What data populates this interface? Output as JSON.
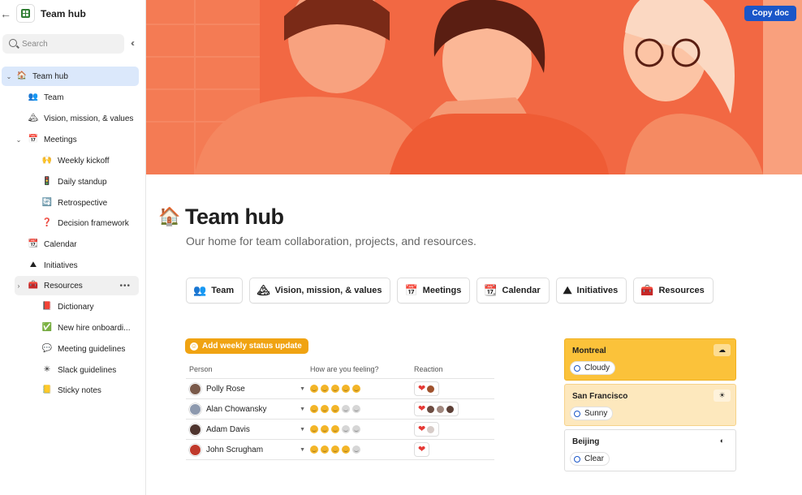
{
  "sidebar": {
    "doc_title": "Team hub",
    "search_placeholder": "Search",
    "items": [
      {
        "label": "Team hub",
        "icon": "🏠"
      },
      {
        "label": "Team",
        "icon": "👥"
      },
      {
        "label": "Vision, mission, & values",
        "icon": "🏔"
      },
      {
        "label": "Meetings",
        "icon": "📅"
      },
      {
        "label": "Weekly kickoff",
        "icon": "🙌"
      },
      {
        "label": "Daily standup",
        "icon": "🚦"
      },
      {
        "label": "Retrospective",
        "icon": "🔄"
      },
      {
        "label": "Decision framework",
        "icon": "❓"
      },
      {
        "label": "Calendar",
        "icon": "📆"
      },
      {
        "label": "Initiatives",
        "icon": "⛰"
      },
      {
        "label": "Resources",
        "icon": "🧰"
      },
      {
        "label": "Dictionary",
        "icon": "📕"
      },
      {
        "label": "New hire onboardi...",
        "icon": "✅"
      },
      {
        "label": "Meeting guidelines",
        "icon": "💬"
      },
      {
        "label": "Slack guidelines",
        "icon": "✳"
      },
      {
        "label": "Sticky notes",
        "icon": "📒"
      }
    ]
  },
  "header": {
    "copy_label": "Copy doc"
  },
  "page": {
    "icon": "🏠",
    "title": "Team hub",
    "subtitle": "Our home for team collaboration, projects, and resources."
  },
  "pills": [
    {
      "label": "Team",
      "icon": "👥"
    },
    {
      "label": "Vision, mission, & values",
      "icon": "🏔"
    },
    {
      "label": "Meetings",
      "icon": "📅"
    },
    {
      "label": "Calendar",
      "icon": "📆"
    },
    {
      "label": "Initiatives",
      "icon": "⛰"
    },
    {
      "label": "Resources",
      "icon": "🧰"
    }
  ],
  "status": {
    "button_label": "Add weekly status update",
    "columns": [
      "Person",
      "How are you feeling?",
      "Reaction"
    ],
    "rows": [
      {
        "name": "Polly Rose",
        "feeling": 5,
        "avatar_color": "#7a5a4a",
        "reactors": [
          "#a0522d"
        ]
      },
      {
        "name": "Alan Chowansky",
        "feeling": 3,
        "avatar_color": "#8d99ae",
        "reactors": [
          "#6d4c41",
          "#a1887f",
          "#5d4037"
        ]
      },
      {
        "name": "Adam Davis",
        "feeling": 3,
        "avatar_color": "#4e342e",
        "reactors": [
          "#d7ccc8"
        ]
      },
      {
        "name": "John Scrugham",
        "feeling": 4,
        "avatar_color": "#c0392b",
        "reactors": []
      }
    ]
  },
  "weather": [
    {
      "city": "Montreal",
      "condition": "Cloudy",
      "icon": "☁",
      "bg": "#fbc23a",
      "border": "#f0b020"
    },
    {
      "city": "San Francisco",
      "condition": "Sunny",
      "icon": "☀",
      "bg": "#fde8bd",
      "border": "#f6d28a"
    },
    {
      "city": "Beijing",
      "condition": "Clear",
      "icon": "◐",
      "bg": "#ffffff",
      "border": "#dddddd"
    }
  ],
  "colors": {
    "accent": "#1a56c8",
    "hero_orange": "#f2663f",
    "status_orange": "#f0a312"
  }
}
